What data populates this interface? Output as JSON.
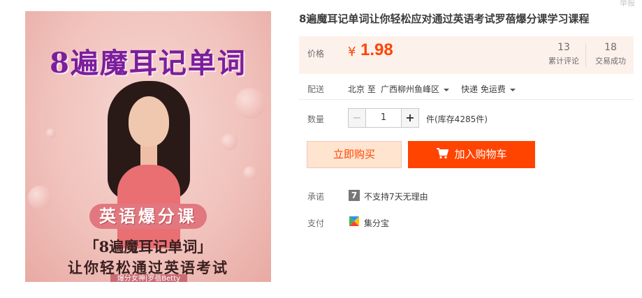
{
  "header": {
    "corner_text": "举报"
  },
  "product": {
    "title": "8遍魔耳记单词让你轻松应对通过英语考试罗蓓爆分课学习课程",
    "image": {
      "heading": "8遍魔耳记单词",
      "banner_course": "英语爆分课",
      "banner_subtitle": "「8遍魔耳记单词」",
      "banner_tagline": "让你轻松通过英语考试",
      "author_tag": "爆分女神|罗蓓Betty"
    }
  },
  "price": {
    "label": "价格",
    "symbol": "¥",
    "value": "1.98",
    "reviews_count": "13",
    "reviews_label": "累计评论",
    "deals_count": "18",
    "deals_label": "交易成功"
  },
  "shipping": {
    "label": "配送",
    "from": "北京 至",
    "to": "广西柳州鱼峰区",
    "method": "快递 免运费"
  },
  "quantity": {
    "label": "数量",
    "value": "1",
    "minus": "−",
    "plus": "+",
    "unit_stock": "件(库存4285件)"
  },
  "actions": {
    "buy_now": "立即购买",
    "add_to_cart": "加入购物车"
  },
  "promise": {
    "label": "承诺",
    "icon_text": "7",
    "text": "不支持7天无理由"
  },
  "payment": {
    "label": "支付",
    "text": "集分宝"
  },
  "colors": {
    "accent": "#ff4400",
    "price_bg": "#fdf1ec",
    "buy_bg": "#ffe4d0"
  }
}
